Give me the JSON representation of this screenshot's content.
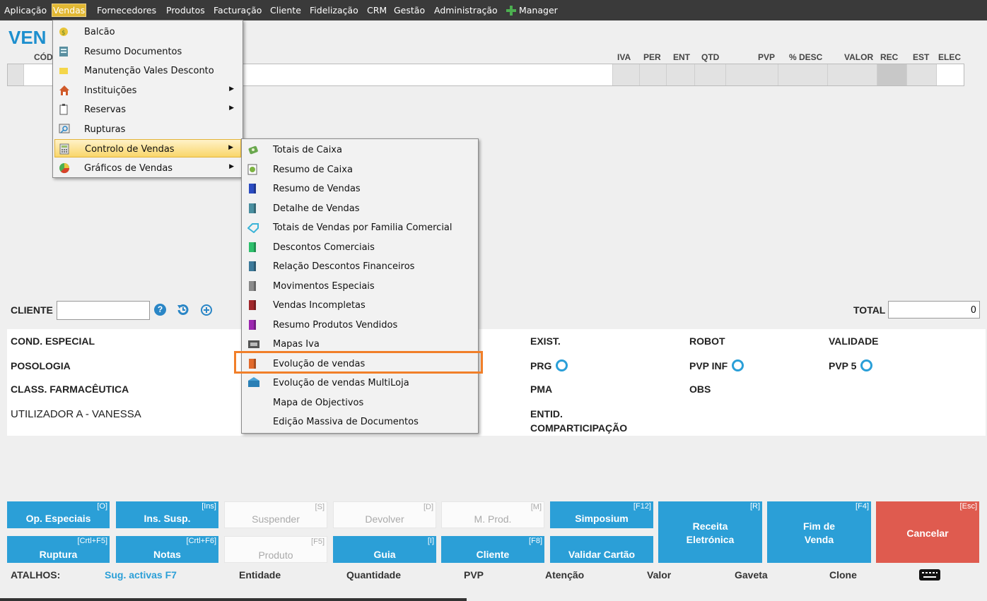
{
  "menubar": {
    "items": [
      "Aplicação",
      "Vendas",
      "Fornecedores",
      "Produtos",
      "Facturação",
      "Cliente",
      "Fidelização",
      "CRM",
      "Gestão",
      "Administração"
    ],
    "manager_label": "Manager"
  },
  "sales": {
    "title": "VEN",
    "code_header": "CÓD",
    "columns": [
      "IVA",
      "PER",
      "ENT",
      "QTD",
      "PVP",
      "% DESC",
      "VALOR",
      "REC",
      "EST",
      "ELEC"
    ]
  },
  "client": {
    "label": "CLIENTE",
    "value": "",
    "total_label": "TOTAL",
    "total_value": "0"
  },
  "info": {
    "cond_especial": "COND. ESPECIAL",
    "posologia": "POSOLOGIA",
    "class_farm": "CLASS. FARMACÊUTICA",
    "utilizador": "UTILIZADOR A - VANESSA",
    "exist": "EXIST.",
    "prg": "PRG",
    "pma": "PMA",
    "entid_1": "ENTID.",
    "entid_2": "COMPARTICIPAÇÃO",
    "robot": "ROBOT",
    "pvp_inf": "PVP INF",
    "obs": "OBS",
    "validade": "VALIDADE",
    "pvp5": "PVP 5"
  },
  "vendas_menu": [
    {
      "label": "Balcão",
      "icon": "coin-icon",
      "submenu": false
    },
    {
      "label": "Resumo Documentos",
      "icon": "document-summary-icon",
      "submenu": false
    },
    {
      "label": "Manutenção Vales Desconto",
      "icon": "voucher-icon",
      "submenu": false
    },
    {
      "label": "Instituições",
      "icon": "house-icon",
      "submenu": true
    },
    {
      "label": "Reservas",
      "icon": "clipboard-icon",
      "submenu": true
    },
    {
      "label": "Rupturas",
      "icon": "magnifier-icon",
      "submenu": false
    },
    {
      "label": "Controlo de Vendas",
      "icon": "calculator-icon",
      "submenu": true
    },
    {
      "label": "Gráficos de Vendas",
      "icon": "pie-chart-icon",
      "submenu": true
    }
  ],
  "controlo_menu": [
    {
      "label": "Totais de Caixa",
      "icon": "money-icon",
      "color": "#6aa84f"
    },
    {
      "label": "Resumo de Caixa",
      "icon": "receipt-icon",
      "color": "#7cb342"
    },
    {
      "label": "Resumo de Vendas",
      "icon": "book-icon",
      "color": "#2b4cc2"
    },
    {
      "label": "Detalhe de Vendas",
      "icon": "book-icon",
      "color": "#4a8fa0"
    },
    {
      "label": "Totais de Vendas por Familia Comercial",
      "icon": "tag-icon",
      "color": "#3bb4d8"
    },
    {
      "label": "Descontos Comerciais",
      "icon": "book-icon",
      "color": "#2ec06c"
    },
    {
      "label": "Relação Descontos Financeiros",
      "icon": "book-icon",
      "color": "#3d7a9a"
    },
    {
      "label": "Movimentos Especiais",
      "icon": "book-icon",
      "color": "#8a8a8a"
    },
    {
      "label": "Vendas Incompletas",
      "icon": "book-icon",
      "color": "#a0282c"
    },
    {
      "label": "Resumo Produtos Vendidos",
      "icon": "book-icon",
      "color": "#9c27b0"
    },
    {
      "label": "Mapas Iva",
      "icon": "map-icon",
      "color": "#555555"
    },
    {
      "label": "Evolução de vendas",
      "icon": "book-icon",
      "color": "#e26a2c"
    },
    {
      "label": "Evolução de vendas MultiLoja",
      "icon": "store-icon",
      "color": "#2a7fb5"
    },
    {
      "label": "Mapa de Objectivos",
      "icon": "",
      "color": ""
    },
    {
      "label": "Edição Massiva de Documentos",
      "icon": "",
      "color": ""
    }
  ],
  "buttons": [
    {
      "label": "Op. Especiais",
      "key": "[O]"
    },
    {
      "label": "Ins. Susp.",
      "key": "[Ins]"
    },
    {
      "label": "Suspender",
      "key": "[S]"
    },
    {
      "label": "Devolver",
      "key": "[D]"
    },
    {
      "label": "M. Prod.",
      "key": "[M]"
    },
    {
      "label": "Simposium",
      "key": "[F12]"
    },
    {
      "label": "Ruptura",
      "key": "[Crtl+F5]"
    },
    {
      "label": "Notas",
      "key": "[Crtl+F6]"
    },
    {
      "label": "Produto",
      "key": "[F5]"
    },
    {
      "label": "Guia",
      "key": "[I]"
    },
    {
      "label": "Cliente",
      "key": "[F8]"
    },
    {
      "label": "Validar Cartão",
      "key": ""
    },
    {
      "label1": "Receita",
      "label2": "Eletrónica",
      "key": "[R]"
    },
    {
      "label1": "Fim de",
      "label2": "Venda",
      "key": "[F4]"
    },
    {
      "label": "Cancelar",
      "key": "[Esc]"
    }
  ],
  "shortcuts": {
    "atalhos": "ATALHOS:",
    "sug": "Sug. activas F7",
    "items": [
      "Entidade",
      "Quantidade",
      "PVP",
      "Atenção",
      "Valor",
      "Gaveta",
      "Clone"
    ]
  },
  "colors": {
    "accent": "#2b9fd7",
    "cancel": "#df5b4f",
    "menubar": "#3a3a3a",
    "highlight": "#f17f29"
  }
}
